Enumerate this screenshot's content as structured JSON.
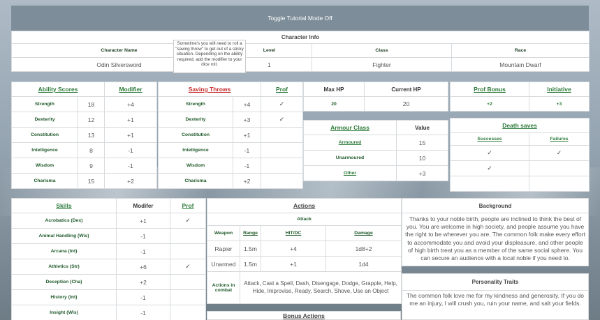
{
  "toggle_label": "Toggle Tutorial Mode Off",
  "character_info": {
    "title": "Character Info",
    "headers": [
      "Character Name",
      "Level",
      "Class",
      "Race"
    ],
    "values": [
      "Odin Silversword",
      "1",
      "Fighter",
      "Mountain Dwarf"
    ]
  },
  "tooltip": "Sometime's you will need to roll a \"saving throw\" to get out of a sticky situation. Depending on the ability required, add the modifier to your dice roll.",
  "abilities": {
    "headers": [
      "Ability Scores",
      "Modifier"
    ],
    "rows": [
      {
        "name": "Strength",
        "score": "18",
        "mod": "+4"
      },
      {
        "name": "Dexterity",
        "score": "12",
        "mod": "+1"
      },
      {
        "name": "Constitution",
        "score": "13",
        "mod": "+1"
      },
      {
        "name": "Intelligence",
        "score": "8",
        "mod": "-1"
      },
      {
        "name": "Wisdom",
        "score": "9",
        "mod": "-1"
      },
      {
        "name": "Charisma",
        "score": "15",
        "mod": "+2"
      }
    ]
  },
  "saving_throws": {
    "headers": [
      "Saving Throws",
      "Prof"
    ],
    "rows": [
      {
        "name": "Strength",
        "mod": "+4",
        "prof": "✓"
      },
      {
        "name": "Dexterity",
        "mod": "+3",
        "prof": "✓"
      },
      {
        "name": "Constitution",
        "mod": "+1",
        "prof": ""
      },
      {
        "name": "Intelligence",
        "mod": "-1",
        "prof": ""
      },
      {
        "name": "Wisdom",
        "mod": "-1",
        "prof": ""
      },
      {
        "name": "Charisma",
        "mod": "+2",
        "prof": ""
      }
    ]
  },
  "hp": {
    "headers": [
      "Max HP",
      "Current HP"
    ],
    "values": [
      "20",
      "20"
    ]
  },
  "prof": {
    "headers": [
      "Prof Bonus",
      "Initiative"
    ],
    "values": [
      "+2",
      "+3"
    ]
  },
  "armour": {
    "headers": [
      "Armour Class",
      "Value"
    ],
    "rows": [
      {
        "name": "Armoured",
        "value": "15"
      },
      {
        "name": "Unarmoured",
        "value": "10"
      },
      {
        "name": "Other",
        "value": "+3"
      }
    ]
  },
  "death_saves": {
    "title": "Death saves",
    "headers": [
      "Successes",
      "Failures"
    ],
    "rows": [
      [
        "✓",
        "✓"
      ],
      [
        "✓",
        ""
      ],
      [
        "",
        ""
      ]
    ]
  },
  "skills": {
    "headers": [
      "Skills",
      "Modifer",
      "Prof"
    ],
    "rows": [
      {
        "name": "Acrobatics (Dex)",
        "mod": "+1",
        "prof": "✓"
      },
      {
        "name": "Animal Handling (Wis)",
        "mod": "-1",
        "prof": ""
      },
      {
        "name": "Arcana (Int)",
        "mod": "-1",
        "prof": ""
      },
      {
        "name": "Athletics (Str)",
        "mod": "+6",
        "prof": "✓"
      },
      {
        "name": "Deception (Cha)",
        "mod": "+2",
        "prof": ""
      },
      {
        "name": "History (Int)",
        "mod": "-1",
        "prof": ""
      },
      {
        "name": "Insight (Wis)",
        "mod": "-1",
        "prof": ""
      }
    ]
  },
  "actions": {
    "title": "Actions",
    "subtitle": "Attack",
    "headers": [
      "Weapon",
      "Range",
      "HIT/DC",
      "Damage"
    ],
    "rows": [
      {
        "weapon": "Rapier",
        "range": "1.5m",
        "hit": "+4",
        "damage": "1d8+2"
      },
      {
        "weapon": "Unarmed",
        "range": "1.5m",
        "hit": "+1",
        "damage": "1d4"
      }
    ],
    "combat_label": "Actions in combat",
    "combat_text": "Attack, Cast a Spell, Dash, Disengage, Dodge, Grapple, Help, Hide, Improvise, Ready, Search, Shove, Use an Object",
    "bonus_title": "Bonus Actions"
  },
  "background": {
    "title": "Background",
    "text": "Thanks to your noble birth, people are inclined to think the best of you. You are welcome in high society, and people assume you have the right to be wherever you are. The common folk make every effort to accommodate you and avoid your displeasure, and other people of high birth treat you as a member of the same social sphere. You can secure an audience with a local noble if you need to."
  },
  "personality": {
    "title": "Personality Traits",
    "text": "The common folk love me for my kindness and generosity. If you do me an injury, I will crush you, ruin your name, and salt your fields."
  }
}
